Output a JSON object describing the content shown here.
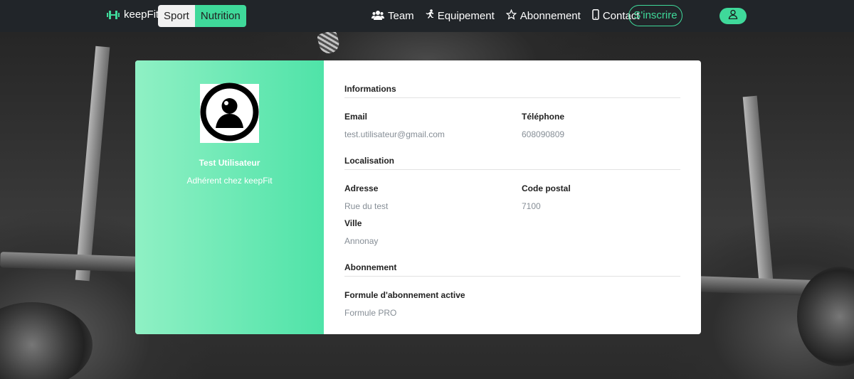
{
  "navbar": {
    "brand": "keepFit",
    "toggle": {
      "sport": "Sport",
      "nutrition": "Nutrition"
    },
    "menu": [
      {
        "label": "Team",
        "icon": "users-icon"
      },
      {
        "label": "Equipement",
        "icon": "running-icon"
      },
      {
        "label": "Abonnement",
        "icon": "star-icon"
      },
      {
        "label": "Contact",
        "icon": "mobile-icon"
      }
    ],
    "signup": "S'inscrire",
    "account_icon": "user-icon"
  },
  "profile": {
    "name": "Test Utilisateur",
    "subtitle": "Adhérent chez keepFit",
    "avatar_icon": "user-circle-icon"
  },
  "sections": {
    "informations": {
      "title": "Informations",
      "email_label": "Email",
      "email_value": "test.utilisateur@gmail.com",
      "phone_label": "Téléphone",
      "phone_value": "608090809"
    },
    "localisation": {
      "title": "Localisation",
      "address_label": "Adresse",
      "address_value": "Rue du test",
      "postal_label": "Code postal",
      "postal_value": "7100",
      "city_label": "Ville",
      "city_value": "Annonay"
    },
    "abonnement": {
      "title": "Abonnement",
      "formula_label": "Formule d'abonnement active",
      "formula_value": "Formule PRO"
    }
  },
  "colors": {
    "accent": "#3fd99a",
    "navbar": "#212529",
    "muted_text": "#868e96"
  }
}
